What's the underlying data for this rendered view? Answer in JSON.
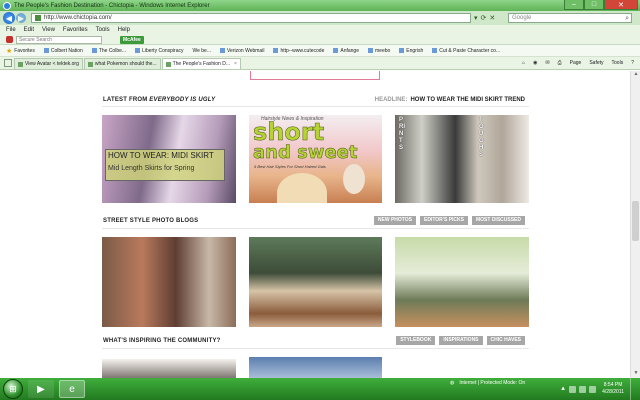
{
  "window": {
    "title": "The People's Fashion Destination - Chictopia - Windows Internet Explorer"
  },
  "addressbar": {
    "url": "http://www.chictopia.com/"
  },
  "searchbar": {
    "placeholder": "Google"
  },
  "menu": [
    "File",
    "Edit",
    "View",
    "Favorites",
    "Tools",
    "Help"
  ],
  "toolbar": {
    "secure_search": "Secure Search",
    "mcafee": "McAfee"
  },
  "favorites": {
    "label": "Favorites",
    "items": [
      "Colbert Nation",
      "The Colbe...",
      "Liberty Conspiracy",
      "We be...",
      "Verizon Webmail",
      "http--www.cutecode",
      "Anfange",
      "meebo",
      "Engrish",
      "Cut & Paste Character co..."
    ]
  },
  "tabs": [
    {
      "label": "View Avatar < tektek.org",
      "active": false
    },
    {
      "label": "what Pokemon should the...",
      "active": false
    },
    {
      "label": "The People's Fashion D...",
      "active": true
    }
  ],
  "commandbar": [
    "Page",
    "Safety",
    "Tools"
  ],
  "sections": {
    "latest": {
      "prefix": "LATEST FROM ",
      "blog": "EVERYBODY IS UGLY"
    },
    "headline": {
      "label": "HEADLINE:",
      "text": "HOW TO WEAR THE MIDI SKIRT TREND"
    },
    "street": {
      "title": "STREET STYLE PHOTO BLOGS",
      "pills": [
        "NEW PHOTOS",
        "EDITOR'S PICKS",
        "MOST DISCUSSED"
      ]
    },
    "inspiring": {
      "title": "WHAT'S INSPIRING THE COMMUNITY?",
      "pills": [
        "STYLEBOOK",
        "INSPIRATIONS",
        "CHIC HAVES"
      ]
    }
  },
  "images": {
    "midi": {
      "line1": "HOW TO WEAR: MIDI SKIRT",
      "line2": "Mid Length Skirts for Spring"
    },
    "short": {
      "top": "Hairstyle News & Inspiration",
      "big1": "short",
      "big2": "and sweet",
      "sub": "5 Best Hair Styles For Short Haired Gals"
    },
    "prints": {
      "left": "PRINTS",
      "right": "TOUGHS"
    }
  },
  "status": {
    "zone": "Internet | Protected Mode: On"
  },
  "clock": {
    "time": "8:54 PM",
    "date": "4/28/2011"
  }
}
